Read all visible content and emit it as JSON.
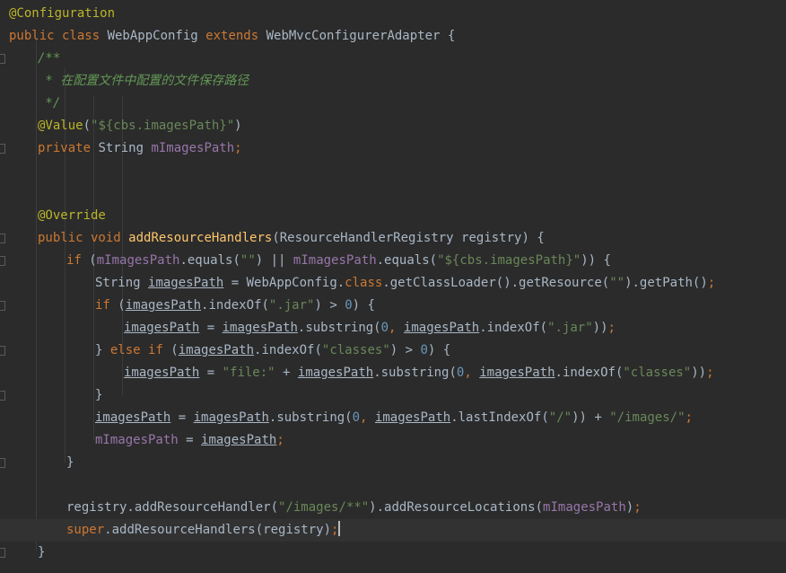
{
  "editor": {
    "colors": {
      "background": "#2b2b2b",
      "current_line": "#323232",
      "keyword": "#cc7832",
      "annotation": "#bbb529",
      "string": "#6a8759",
      "number": "#6897bb",
      "field": "#9876aa",
      "method": "#ffc66d",
      "doc_comment": "#629755",
      "plain": "#a9b7c6"
    },
    "current_line_index": 23,
    "lines": [
      {
        "indent": 0,
        "tokens": [
          {
            "t": "@Configuration",
            "c": "ann"
          }
        ]
      },
      {
        "indent": 0,
        "tokens": [
          {
            "t": "public class ",
            "c": "kw"
          },
          {
            "t": "WebAppConfig ",
            "c": "plain"
          },
          {
            "t": "extends ",
            "c": "kw"
          },
          {
            "t": "WebMvcConfigurerAdapter {",
            "c": "plain"
          }
        ]
      },
      {
        "indent": 1,
        "tokens": [
          {
            "t": "/**",
            "c": "doc"
          }
        ]
      },
      {
        "indent": 1,
        "tokens": [
          {
            "t": " * 在配置文件中配置的文件保存路径",
            "c": "doc"
          }
        ]
      },
      {
        "indent": 1,
        "tokens": [
          {
            "t": " */",
            "c": "doc"
          }
        ]
      },
      {
        "indent": 1,
        "tokens": [
          {
            "t": "@Value",
            "c": "ann"
          },
          {
            "t": "(",
            "c": "plain"
          },
          {
            "t": "\"${cbs.imagesPath}\"",
            "c": "str"
          },
          {
            "t": ")",
            "c": "plain"
          }
        ]
      },
      {
        "indent": 1,
        "tokens": [
          {
            "t": "private ",
            "c": "kw"
          },
          {
            "t": "String ",
            "c": "plain"
          },
          {
            "t": "mImagesPath",
            "c": "field"
          },
          {
            "t": ";",
            "c": "kw"
          }
        ]
      },
      {
        "indent": 0,
        "tokens": []
      },
      {
        "indent": 0,
        "tokens": []
      },
      {
        "indent": 1,
        "tokens": [
          {
            "t": "@Override",
            "c": "ann"
          }
        ]
      },
      {
        "indent": 1,
        "tokens": [
          {
            "t": "public void ",
            "c": "kw"
          },
          {
            "t": "addResourceHandlers",
            "c": "method"
          },
          {
            "t": "(ResourceHandlerRegistry registry) {",
            "c": "plain"
          }
        ]
      },
      {
        "indent": 2,
        "tokens": [
          {
            "t": "if ",
            "c": "kw"
          },
          {
            "t": "(",
            "c": "plain"
          },
          {
            "t": "mImagesPath",
            "c": "field"
          },
          {
            "t": ".equals(",
            "c": "plain"
          },
          {
            "t": "\"\"",
            "c": "str"
          },
          {
            "t": ") || ",
            "c": "plain"
          },
          {
            "t": "mImagesPath",
            "c": "field"
          },
          {
            "t": ".equals(",
            "c": "plain"
          },
          {
            "t": "\"${cbs.imagesPath}\"",
            "c": "str"
          },
          {
            "t": ")) {",
            "c": "plain"
          }
        ]
      },
      {
        "indent": 3,
        "tokens": [
          {
            "t": "String ",
            "c": "plain"
          },
          {
            "t": "imagesPath",
            "c": "under"
          },
          {
            "t": " = WebAppConfig.",
            "c": "plain"
          },
          {
            "t": "class",
            "c": "kw"
          },
          {
            "t": ".getClassLoader().getResource(",
            "c": "plain"
          },
          {
            "t": "\"\"",
            "c": "str"
          },
          {
            "t": ").getPath()",
            "c": "plain"
          },
          {
            "t": ";",
            "c": "kw"
          }
        ]
      },
      {
        "indent": 3,
        "tokens": [
          {
            "t": "if ",
            "c": "kw"
          },
          {
            "t": "(",
            "c": "plain"
          },
          {
            "t": "imagesPath",
            "c": "under"
          },
          {
            "t": ".indexOf(",
            "c": "plain"
          },
          {
            "t": "\".jar\"",
            "c": "str"
          },
          {
            "t": ") > ",
            "c": "plain"
          },
          {
            "t": "0",
            "c": "num"
          },
          {
            "t": ") {",
            "c": "plain"
          }
        ]
      },
      {
        "indent": 4,
        "tokens": [
          {
            "t": "imagesPath",
            "c": "under"
          },
          {
            "t": " = ",
            "c": "plain"
          },
          {
            "t": "imagesPath",
            "c": "under"
          },
          {
            "t": ".substring(",
            "c": "plain"
          },
          {
            "t": "0",
            "c": "num"
          },
          {
            "t": ", ",
            "c": "kw"
          },
          {
            "t": "imagesPath",
            "c": "under"
          },
          {
            "t": ".indexOf(",
            "c": "plain"
          },
          {
            "t": "\".jar\"",
            "c": "str"
          },
          {
            "t": "))",
            "c": "plain"
          },
          {
            "t": ";",
            "c": "kw"
          }
        ]
      },
      {
        "indent": 3,
        "tokens": [
          {
            "t": "} ",
            "c": "plain"
          },
          {
            "t": "else if ",
            "c": "kw"
          },
          {
            "t": "(",
            "c": "plain"
          },
          {
            "t": "imagesPath",
            "c": "under"
          },
          {
            "t": ".indexOf(",
            "c": "plain"
          },
          {
            "t": "\"classes\"",
            "c": "str"
          },
          {
            "t": ") > ",
            "c": "plain"
          },
          {
            "t": "0",
            "c": "num"
          },
          {
            "t": ") {",
            "c": "plain"
          }
        ]
      },
      {
        "indent": 4,
        "tokens": [
          {
            "t": "imagesPath",
            "c": "under"
          },
          {
            "t": " = ",
            "c": "plain"
          },
          {
            "t": "\"file:\"",
            "c": "str"
          },
          {
            "t": " + ",
            "c": "plain"
          },
          {
            "t": "imagesPath",
            "c": "under"
          },
          {
            "t": ".substring(",
            "c": "plain"
          },
          {
            "t": "0",
            "c": "num"
          },
          {
            "t": ", ",
            "c": "kw"
          },
          {
            "t": "imagesPath",
            "c": "under"
          },
          {
            "t": ".indexOf(",
            "c": "plain"
          },
          {
            "t": "\"classes\"",
            "c": "str"
          },
          {
            "t": "))",
            "c": "plain"
          },
          {
            "t": ";",
            "c": "kw"
          }
        ]
      },
      {
        "indent": 3,
        "tokens": [
          {
            "t": "}",
            "c": "plain"
          }
        ]
      },
      {
        "indent": 3,
        "tokens": [
          {
            "t": "imagesPath",
            "c": "under"
          },
          {
            "t": " = ",
            "c": "plain"
          },
          {
            "t": "imagesPath",
            "c": "under"
          },
          {
            "t": ".substring(",
            "c": "plain"
          },
          {
            "t": "0",
            "c": "num"
          },
          {
            "t": ", ",
            "c": "kw"
          },
          {
            "t": "imagesPath",
            "c": "under"
          },
          {
            "t": ".lastIndexOf(",
            "c": "plain"
          },
          {
            "t": "\"/\"",
            "c": "str"
          },
          {
            "t": ")) + ",
            "c": "plain"
          },
          {
            "t": "\"/images/\"",
            "c": "str"
          },
          {
            "t": ";",
            "c": "kw"
          }
        ]
      },
      {
        "indent": 3,
        "tokens": [
          {
            "t": "mImagesPath",
            "c": "field"
          },
          {
            "t": " = ",
            "c": "plain"
          },
          {
            "t": "imagesPath",
            "c": "under"
          },
          {
            "t": ";",
            "c": "kw"
          }
        ]
      },
      {
        "indent": 2,
        "tokens": [
          {
            "t": "}",
            "c": "plain"
          }
        ]
      },
      {
        "indent": 0,
        "tokens": []
      },
      {
        "indent": 2,
        "tokens": [
          {
            "t": "registry.addResourceHandler(",
            "c": "plain"
          },
          {
            "t": "\"/images/**\"",
            "c": "str"
          },
          {
            "t": ").addResourceLocations(",
            "c": "plain"
          },
          {
            "t": "mImagesPath",
            "c": "field"
          },
          {
            "t": ")",
            "c": "plain"
          },
          {
            "t": ";",
            "c": "kw"
          }
        ]
      },
      {
        "indent": 2,
        "tokens": [
          {
            "t": "super",
            "c": "kw"
          },
          {
            "t": ".addResourceHandlers(registry)",
            "c": "plain"
          },
          {
            "t": ";",
            "c": "kw"
          }
        ],
        "caret": true
      },
      {
        "indent": 1,
        "tokens": [
          {
            "t": "}",
            "c": "plain"
          }
        ]
      }
    ]
  }
}
